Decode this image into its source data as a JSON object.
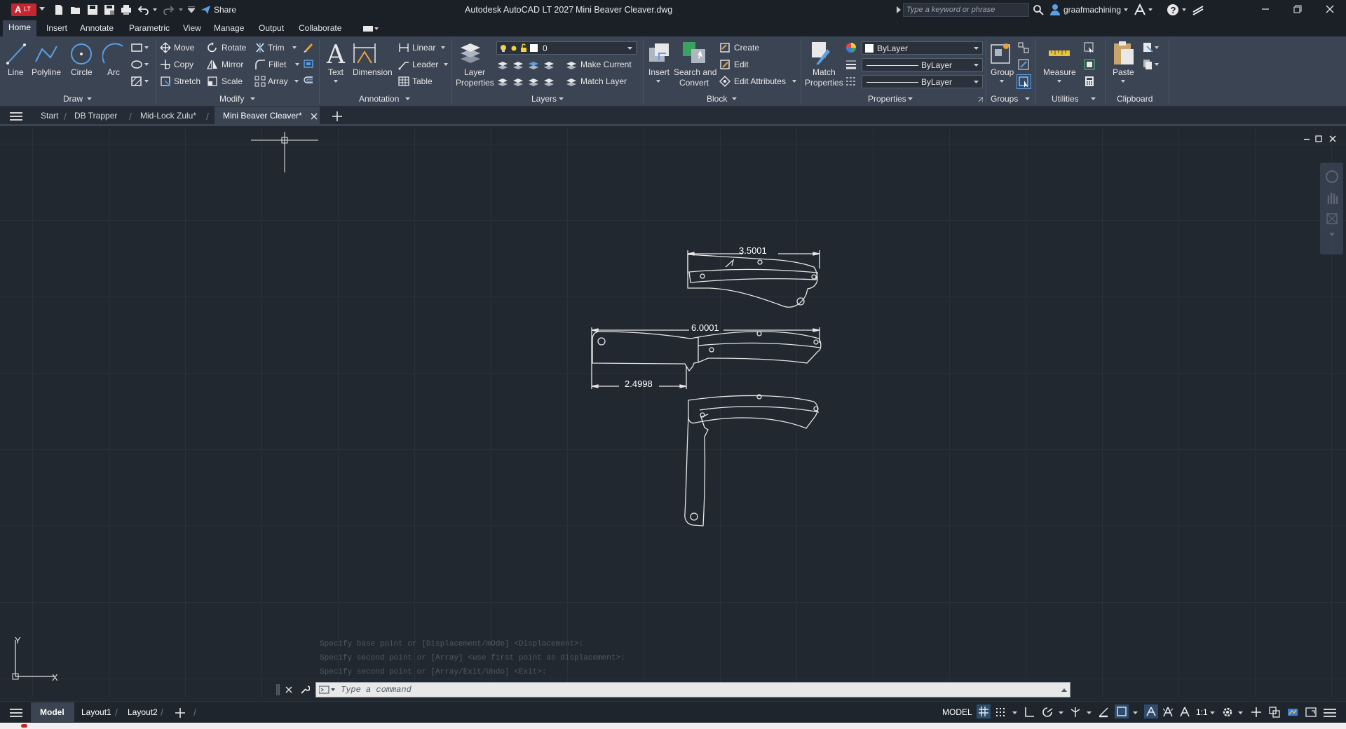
{
  "titlebar": {
    "app_badge": "A",
    "app_badge_sub": "LT",
    "share_label": "Share",
    "title": "Autodesk AutoCAD LT 2027",
    "document": "Mini Beaver Cleaver.dwg",
    "search_placeholder": "Type a keyword or phrase",
    "user": "graafmachining",
    "accent_color": "#c7262f"
  },
  "ribbon_tabs": [
    "Home",
    "Insert",
    "Annotate",
    "Parametric",
    "View",
    "Manage",
    "Output",
    "Collaborate"
  ],
  "ribbon": {
    "draw": {
      "title": "Draw",
      "line": "Line",
      "polyline": "Polyline",
      "circle": "Circle",
      "arc": "Arc"
    },
    "modify": {
      "title": "Modify",
      "move": "Move",
      "rotate": "Rotate",
      "trim": "Trim",
      "copy": "Copy",
      "mirror": "Mirror",
      "fillet": "Fillet",
      "stretch": "Stretch",
      "scale": "Scale",
      "array": "Array"
    },
    "annotation": {
      "title": "Annotation",
      "text": "Text",
      "dimension": "Dimension",
      "linear": "Linear",
      "leader": "Leader",
      "table": "Table"
    },
    "layers": {
      "title": "Layers",
      "layer_properties_1": "Layer",
      "layer_properties_2": "Properties",
      "current_layer": "0",
      "make_current": "Make Current",
      "match_layer": "Match Layer"
    },
    "block": {
      "title": "Block",
      "insert": "Insert",
      "search_convert_1": "Search and",
      "search_convert_2": "Convert",
      "create": "Create",
      "edit": "Edit",
      "edit_attributes": "Edit Attributes"
    },
    "properties": {
      "title": "Properties",
      "match_1": "Match",
      "match_2": "Properties",
      "color": "ByLayer",
      "linetype": "ByLayer",
      "lineweight": "ByLayer"
    },
    "groups": {
      "title": "Groups",
      "group": "Group"
    },
    "utilities": {
      "title": "Utilities",
      "measure": "Measure"
    },
    "clipboard": {
      "title": "Clipboard",
      "paste": "Paste"
    }
  },
  "file_tabs": [
    "Start",
    "DB Trapper",
    "Mid-Lock Zulu*",
    "Mini Beaver Cleaver*"
  ],
  "drawing": {
    "dim_top": "3.5001",
    "dim_middle": "6.0001",
    "dim_lower": "2.4998"
  },
  "ucs": {
    "x": "X",
    "y": "Y"
  },
  "command_history": [
    "Specify base point or [Displacement/mOde] <Displacement>:",
    "Specify second point or [Array] <use first point as displacement>:",
    "Specify second point or [Array/Exit/Undo] <Exit>:"
  ],
  "command_placeholder": "Type a command",
  "layout_tabs": [
    "Model",
    "Layout1",
    "Layout2"
  ],
  "status": {
    "model": "MODEL",
    "scale": "1:1"
  }
}
